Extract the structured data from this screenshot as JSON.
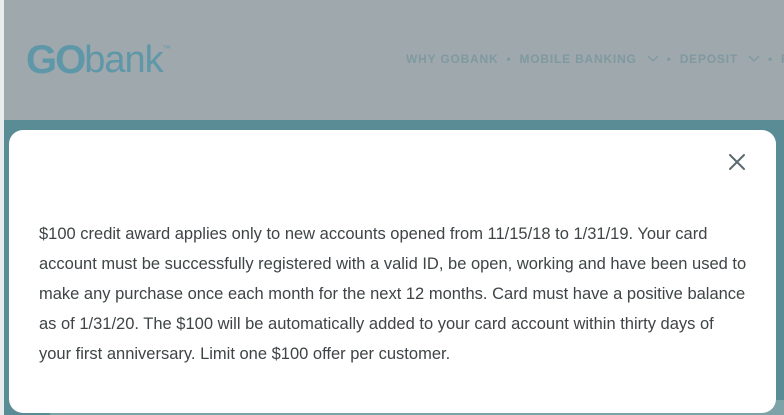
{
  "logo": {
    "go": "GO",
    "bank": "bank",
    "tm": "™"
  },
  "nav": {
    "items": [
      {
        "label": "WHY GOBANK",
        "dropdown": false
      },
      {
        "label": "MOBILE BANKING",
        "dropdown": true
      },
      {
        "label": "DEPOSIT",
        "dropdown": true
      },
      {
        "label": "P",
        "dropdown": false
      }
    ],
    "separator": "•"
  },
  "modal": {
    "close_icon": "close-icon",
    "text": "$100 credit award applies only to new accounts opened from 11/15/18 to 1/31/19. Your card account must be successfully registered with a valid ID, be open, working and have been used to make any purchase once each month for the next 12 months. Card must have a positive balance as of 1/31/20. The $100 will be automatically added to your card account within thirty days of your first anniversary. Limit one $100 offer per customer."
  },
  "colors": {
    "overlay": "#8ea3a8",
    "header_bg": "#9fa8ad",
    "brand_teal": "#5e98a8",
    "band": "#5a8c95",
    "modal_bg": "#ffffff",
    "text": "#3f4446"
  }
}
